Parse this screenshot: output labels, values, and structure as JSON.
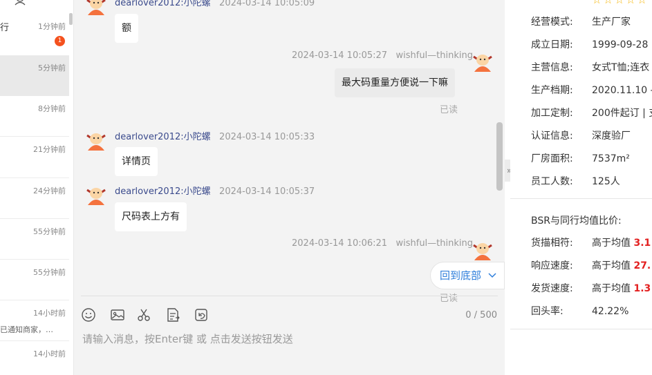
{
  "conversation_list": {
    "items": [
      {
        "name": "行",
        "time": "1分钟前",
        "badge": "1",
        "preview": ""
      },
      {
        "name": "",
        "time": "5分钟前",
        "badge": "",
        "preview": ""
      },
      {
        "name": "",
        "time": "8分钟前",
        "badge": "",
        "preview": ""
      },
      {
        "name": "",
        "time": "21分钟前",
        "badge": "",
        "preview": ""
      },
      {
        "name": "",
        "time": "24分钟前",
        "badge": "",
        "preview": ""
      },
      {
        "name": "",
        "time": "55分钟前",
        "badge": "",
        "preview": ""
      },
      {
        "name": "",
        "time": "55分钟前",
        "badge": "",
        "preview": ""
      },
      {
        "name": "",
        "time": "14小时前",
        "badge": "",
        "preview": "已通知商家，…"
      },
      {
        "name": "",
        "time": "14小时前",
        "badge": "",
        "preview": ""
      }
    ]
  },
  "chat": {
    "messages": [
      {
        "side": "left",
        "sender": "dearlover2012:小陀螺",
        "time": "2024-03-14 10:05:09",
        "text": "额"
      },
      {
        "side": "right",
        "sender": "wishful—thinking",
        "time": "2024-03-14 10:05:27",
        "text": "最大码重量方便说一下嘛",
        "status": "已读"
      },
      {
        "side": "left",
        "sender": "dearlover2012:小陀螺",
        "time": "2024-03-14 10:05:33",
        "text": "详情页"
      },
      {
        "side": "left",
        "sender": "dearlover2012:小陀螺",
        "time": "2024-03-14 10:05:37",
        "text": "尺码表上方有"
      },
      {
        "side": "right",
        "sender": "wishful—thinking",
        "time": "2024-03-14 10:06:21",
        "text": "",
        "status": "已读"
      }
    ],
    "back_to_bottom": "回到底部",
    "composer": {
      "placeholder": "请输入消息，按Enter键 或 点击发送按钮发送",
      "counter": "0 / 500",
      "tools": [
        "emoji-icon",
        "image-icon",
        "scissors-icon",
        "document-icon",
        "history-icon"
      ]
    }
  },
  "info": {
    "rows": [
      {
        "key": "经营模式:",
        "value": "生产厂家"
      },
      {
        "key": "成立日期:",
        "value": "1999-09-28"
      },
      {
        "key": "主营信息:",
        "value": "女式T恤;连衣"
      },
      {
        "key": "生产档期:",
        "value": "2020.11.10 -"
      },
      {
        "key": "加工定制:",
        "value": "200件起订 | 支"
      },
      {
        "key": "认证信息:",
        "value": "深度验厂"
      },
      {
        "key": "厂房面积:",
        "value": "7537m²"
      },
      {
        "key": "员工人数:",
        "value": "125人"
      }
    ],
    "bsr_title": "BSR与同行均值比价:",
    "bsr_rows": [
      {
        "key": "货描相符:",
        "value": "高于均值",
        "highlight": "3.1"
      },
      {
        "key": "响应速度:",
        "value": "高于均值",
        "highlight": "27."
      },
      {
        "key": "发货速度:",
        "value": "高于均值",
        "highlight": "1.3"
      },
      {
        "key": "回头率:",
        "value": "42.22%",
        "highlight": ""
      }
    ],
    "star_color": "#f5b400",
    "highlight_color": "#e32020"
  }
}
